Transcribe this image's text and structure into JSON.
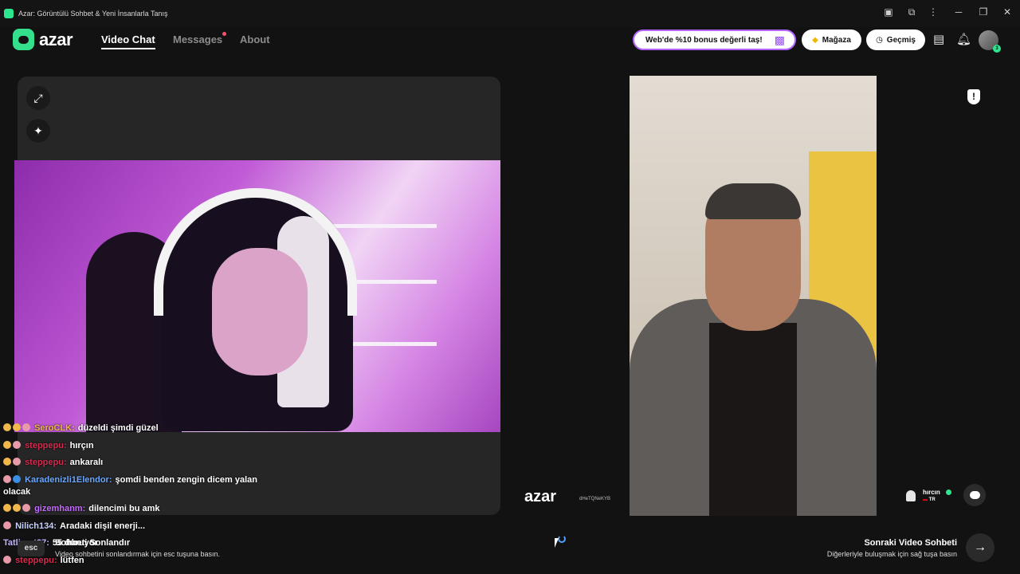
{
  "window": {
    "title": "Azar: Görüntülü Sohbet & Yeni İnsanlarla Tanış",
    "controls": {
      "minimize": "─",
      "restore": "❐",
      "close": "✕"
    }
  },
  "nav": {
    "logo_text": "azar",
    "tabs": [
      {
        "label": "Video Chat",
        "active": true
      },
      {
        "label": "Messages",
        "active": false,
        "has_dot": true
      },
      {
        "label": "About",
        "active": false
      }
    ],
    "promo_label": "Web'de %10 bonus değerli taş!",
    "shop_label": "Mağaza",
    "history_label": "Geçmiş",
    "avatar_badge": "3"
  },
  "left_panel": {
    "expand_icon": "⤢",
    "magic_icon": "✦"
  },
  "right_video": {
    "watermark": "azar",
    "watermark_id": "dHeTQNeKYB",
    "peer_name": "hırcın",
    "peer_country": "TR"
  },
  "chat_overlay": [
    {
      "user": "SeroCLK:",
      "text": "düzeldi şimdi güzel",
      "color": "#f0b84a"
    },
    {
      "user": "steppepu:",
      "text": "hırçın",
      "color": "#d22b4e"
    },
    {
      "user": "steppepu:",
      "text": "ankaralı",
      "color": "#d22b4e"
    },
    {
      "user": "Karadenizli1Elendor:",
      "text": "şomdi benden zengin dicem yalan",
      "color": "#6aa7ff"
    },
    {
      "user": "",
      "text": "olacak",
      "color": "#ffffff"
    },
    {
      "user": "gizemhanm:",
      "text": "dilencimi bu amk",
      "color": "#c46bff"
    },
    {
      "user": "Nilich134:",
      "text": "Aradaki dişil enerji...",
      "color": "#c7d2ff"
    },
    {
      "user": "Tatlisert87:",
      "text": "55 duruyor",
      "color": "#c7b3ff"
    },
    {
      "user": "steppepu:",
      "text": "lütfen",
      "color": "#d22b4e"
    }
  ],
  "footer": {
    "esc_key": "esc",
    "end_title": "Sohbeti Sonlandır",
    "end_subtitle": "Video sohbetini sonlandırmak için esc tuşuna basın.",
    "next_title": "Sonraki Video Sohbeti",
    "next_subtitle": "Diğerleriyle buluşmak için sağ tuşa basın",
    "next_arrow": "→"
  },
  "colors": {
    "brand": "#35e08d",
    "promo_border": "#b266ff",
    "notification_dot": "#ff4d6d"
  }
}
